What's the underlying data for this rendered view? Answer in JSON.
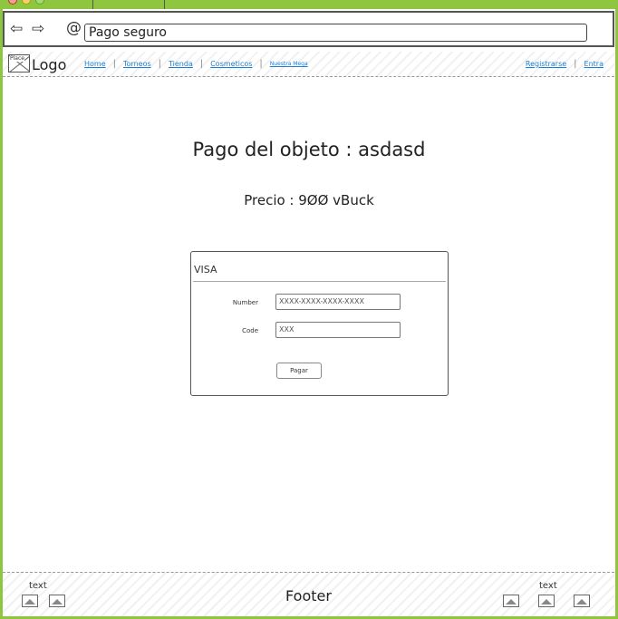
{
  "browser": {
    "address": "Pago seguro",
    "back_icon": "⇦",
    "forward_icon": "⇨",
    "at_icon": "@"
  },
  "nav": {
    "logo_image_label": "Place",
    "logo_text": "Logo",
    "links": [
      "Home",
      "Torneos",
      "Tienda",
      "Cosmeticos",
      "Nuestra Mega"
    ],
    "right_links": [
      "Registrarse",
      "Entra"
    ]
  },
  "main": {
    "title": "Pago del objeto : asdasd",
    "price": "Precio : 9ØØ vBuck"
  },
  "payment": {
    "header": "VISA",
    "number_label": "Number",
    "number_placeholder": "XXXX-XXXX-XXXX-XXXX",
    "code_label": "Code",
    "code_placeholder": "XXX",
    "pay_button": "Pagar"
  },
  "footer": {
    "left_text": "text",
    "center": "Footer",
    "right_text": "text"
  },
  "colors": {
    "frame_accent": "#8ec63f",
    "link": "#1a7fd4"
  }
}
